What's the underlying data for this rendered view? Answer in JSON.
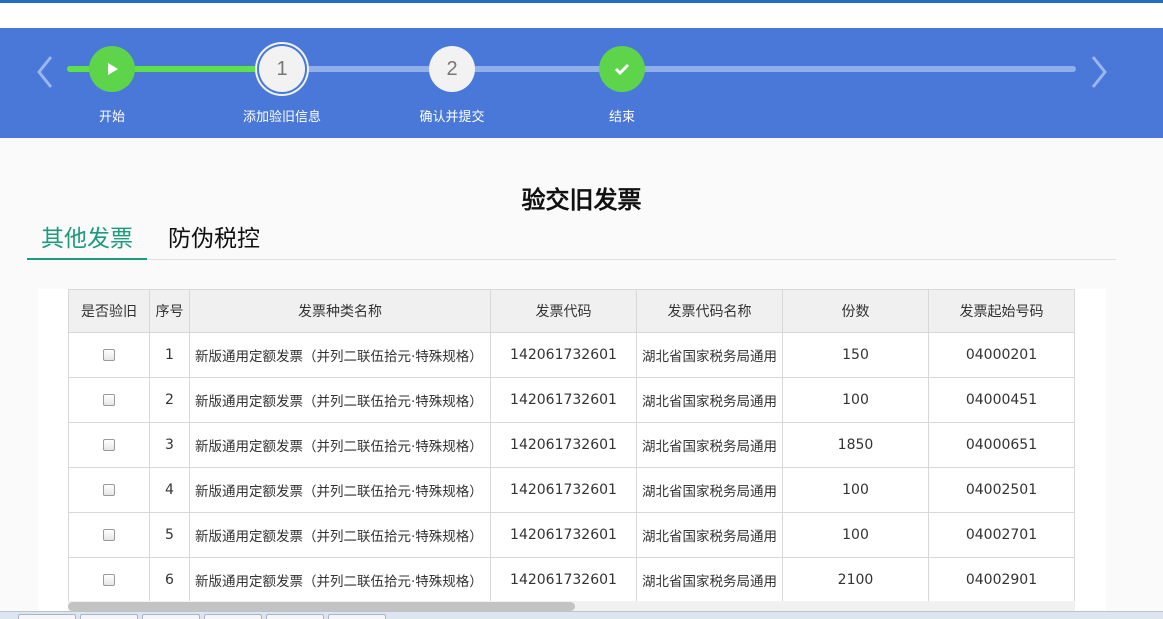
{
  "steps": [
    {
      "label": "开始",
      "number": ""
    },
    {
      "label": "添加验旧信息",
      "number": "1"
    },
    {
      "label": "确认并提交",
      "number": "2"
    },
    {
      "label": "结束",
      "number": ""
    }
  ],
  "page_title": "验交旧发票",
  "tabs": [
    {
      "label": "其他发票",
      "active": true
    },
    {
      "label": "防伪税控",
      "active": false
    }
  ],
  "table": {
    "headers": [
      "是否验旧",
      "序号",
      "发票种类名称",
      "发票代码",
      "发票代码名称",
      "份数",
      "发票起始号码"
    ],
    "rows": [
      {
        "index": "1",
        "type_name": "新版通用定额发票（并列二联伍拾元·特殊规格）",
        "code": "142061732601",
        "code_name": "湖北省国家税务局通用",
        "count": "150",
        "start_no": "04000201"
      },
      {
        "index": "2",
        "type_name": "新版通用定额发票（并列二联伍拾元·特殊规格）",
        "code": "142061732601",
        "code_name": "湖北省国家税务局通用",
        "count": "100",
        "start_no": "04000451"
      },
      {
        "index": "3",
        "type_name": "新版通用定额发票（并列二联伍拾元·特殊规格）",
        "code": "142061732601",
        "code_name": "湖北省国家税务局通用",
        "count": "1850",
        "start_no": "04000651"
      },
      {
        "index": "4",
        "type_name": "新版通用定额发票（并列二联伍拾元·特殊规格）",
        "code": "142061732601",
        "code_name": "湖北省国家税务局通用",
        "count": "100",
        "start_no": "04002501"
      },
      {
        "index": "5",
        "type_name": "新版通用定额发票（并列二联伍拾元·特殊规格）",
        "code": "142061732601",
        "code_name": "湖北省国家税务局通用",
        "count": "100",
        "start_no": "04002701"
      },
      {
        "index": "6",
        "type_name": "新版通用定额发票（并列二联伍拾元·特殊规格）",
        "code": "142061732601",
        "code_name": "湖北省国家税务局通用",
        "count": "2100",
        "start_no": "04002901"
      }
    ]
  },
  "colors": {
    "stepbar_bg": "#4a78d8",
    "progress_done": "#5ee04a",
    "tab_active": "#1e9a7f"
  },
  "icons": {
    "step1": "play-icon",
    "step4": "checkmark-icon",
    "prev": "chevron-left-icon",
    "next": "chevron-right-icon"
  }
}
